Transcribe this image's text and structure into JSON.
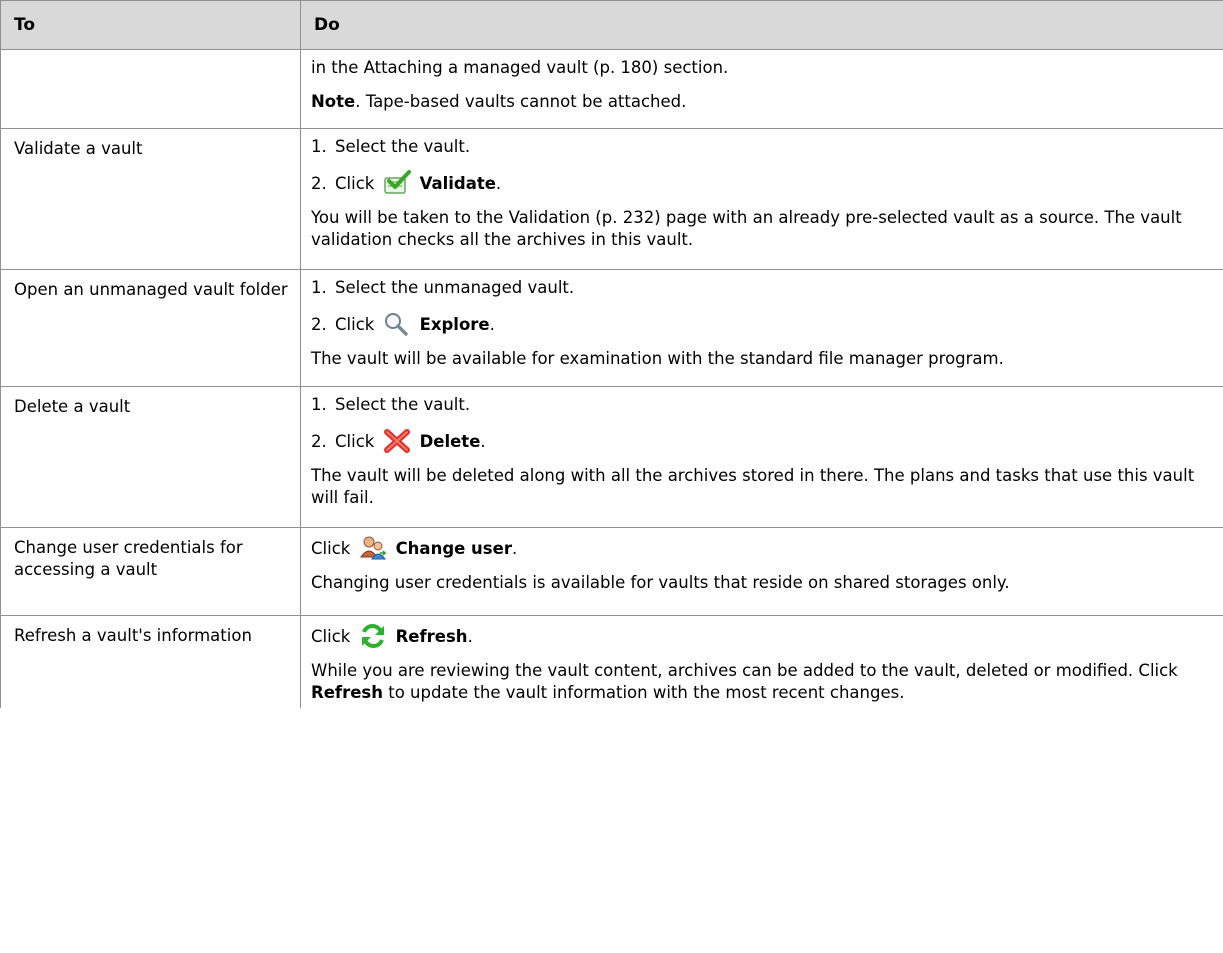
{
  "header": {
    "col_to": "To",
    "col_do": "Do"
  },
  "row_attach": {
    "text": "in the Attaching a managed vault (p. 180) section.",
    "note_label": "Note",
    "note_text": ". Tape-based vaults cannot be attached."
  },
  "row_validate": {
    "task": "Validate a vault",
    "step1_num": "1.",
    "step1": "Select the vault.",
    "step2_num": "2.",
    "step2_click": "Click",
    "step2_action": "Validate",
    "step2_end": ".",
    "icon": "validate-check-icon",
    "desc": "You will be taken to the Validation (p. 232) page with an already pre-selected vault as a source. The vault validation checks all the archives in this vault."
  },
  "row_explore": {
    "task": "Open an unmanaged vault folder",
    "step1_num": "1.",
    "step1": "Select the unmanaged vault.",
    "step2_num": "2.",
    "step2_click": "Click",
    "step2_action": "Explore",
    "step2_end": ".",
    "icon": "magnifier-icon",
    "desc": "The vault will be available for examination with the standard file manager program."
  },
  "row_delete": {
    "task": "Delete a vault",
    "step1_num": "1.",
    "step1": "Select the vault.",
    "step2_num": "2.",
    "step2_click": "Click",
    "step2_action": "Delete",
    "step2_end": ".",
    "icon": "delete-x-icon",
    "desc": "The vault will be deleted along with all the archives stored in there. The plans and tasks that use this vault will fail."
  },
  "row_change_user": {
    "task": "Change user credentials for accessing a vault",
    "click": "Click",
    "action": "Change user",
    "end": ".",
    "icon": "change-user-icon",
    "desc": "Changing user credentials is available for vaults that reside on shared storages only."
  },
  "row_refresh": {
    "task": "Refresh a vault's information",
    "click": "Click",
    "action": "Refresh",
    "end": ".",
    "icon": "refresh-icon",
    "desc_a": "While you are reviewing the vault content, archives can be added to the vault, deleted or modified. Click ",
    "desc_bold": "Refresh",
    "desc_b": " to update the vault information with the most recent changes."
  },
  "colors": {
    "header_bg": "#d9d9d9",
    "border": "#8f8f8f",
    "check_green": "#3aa52b",
    "delete_red": "#e0322a",
    "refresh_green": "#2fb02f"
  }
}
